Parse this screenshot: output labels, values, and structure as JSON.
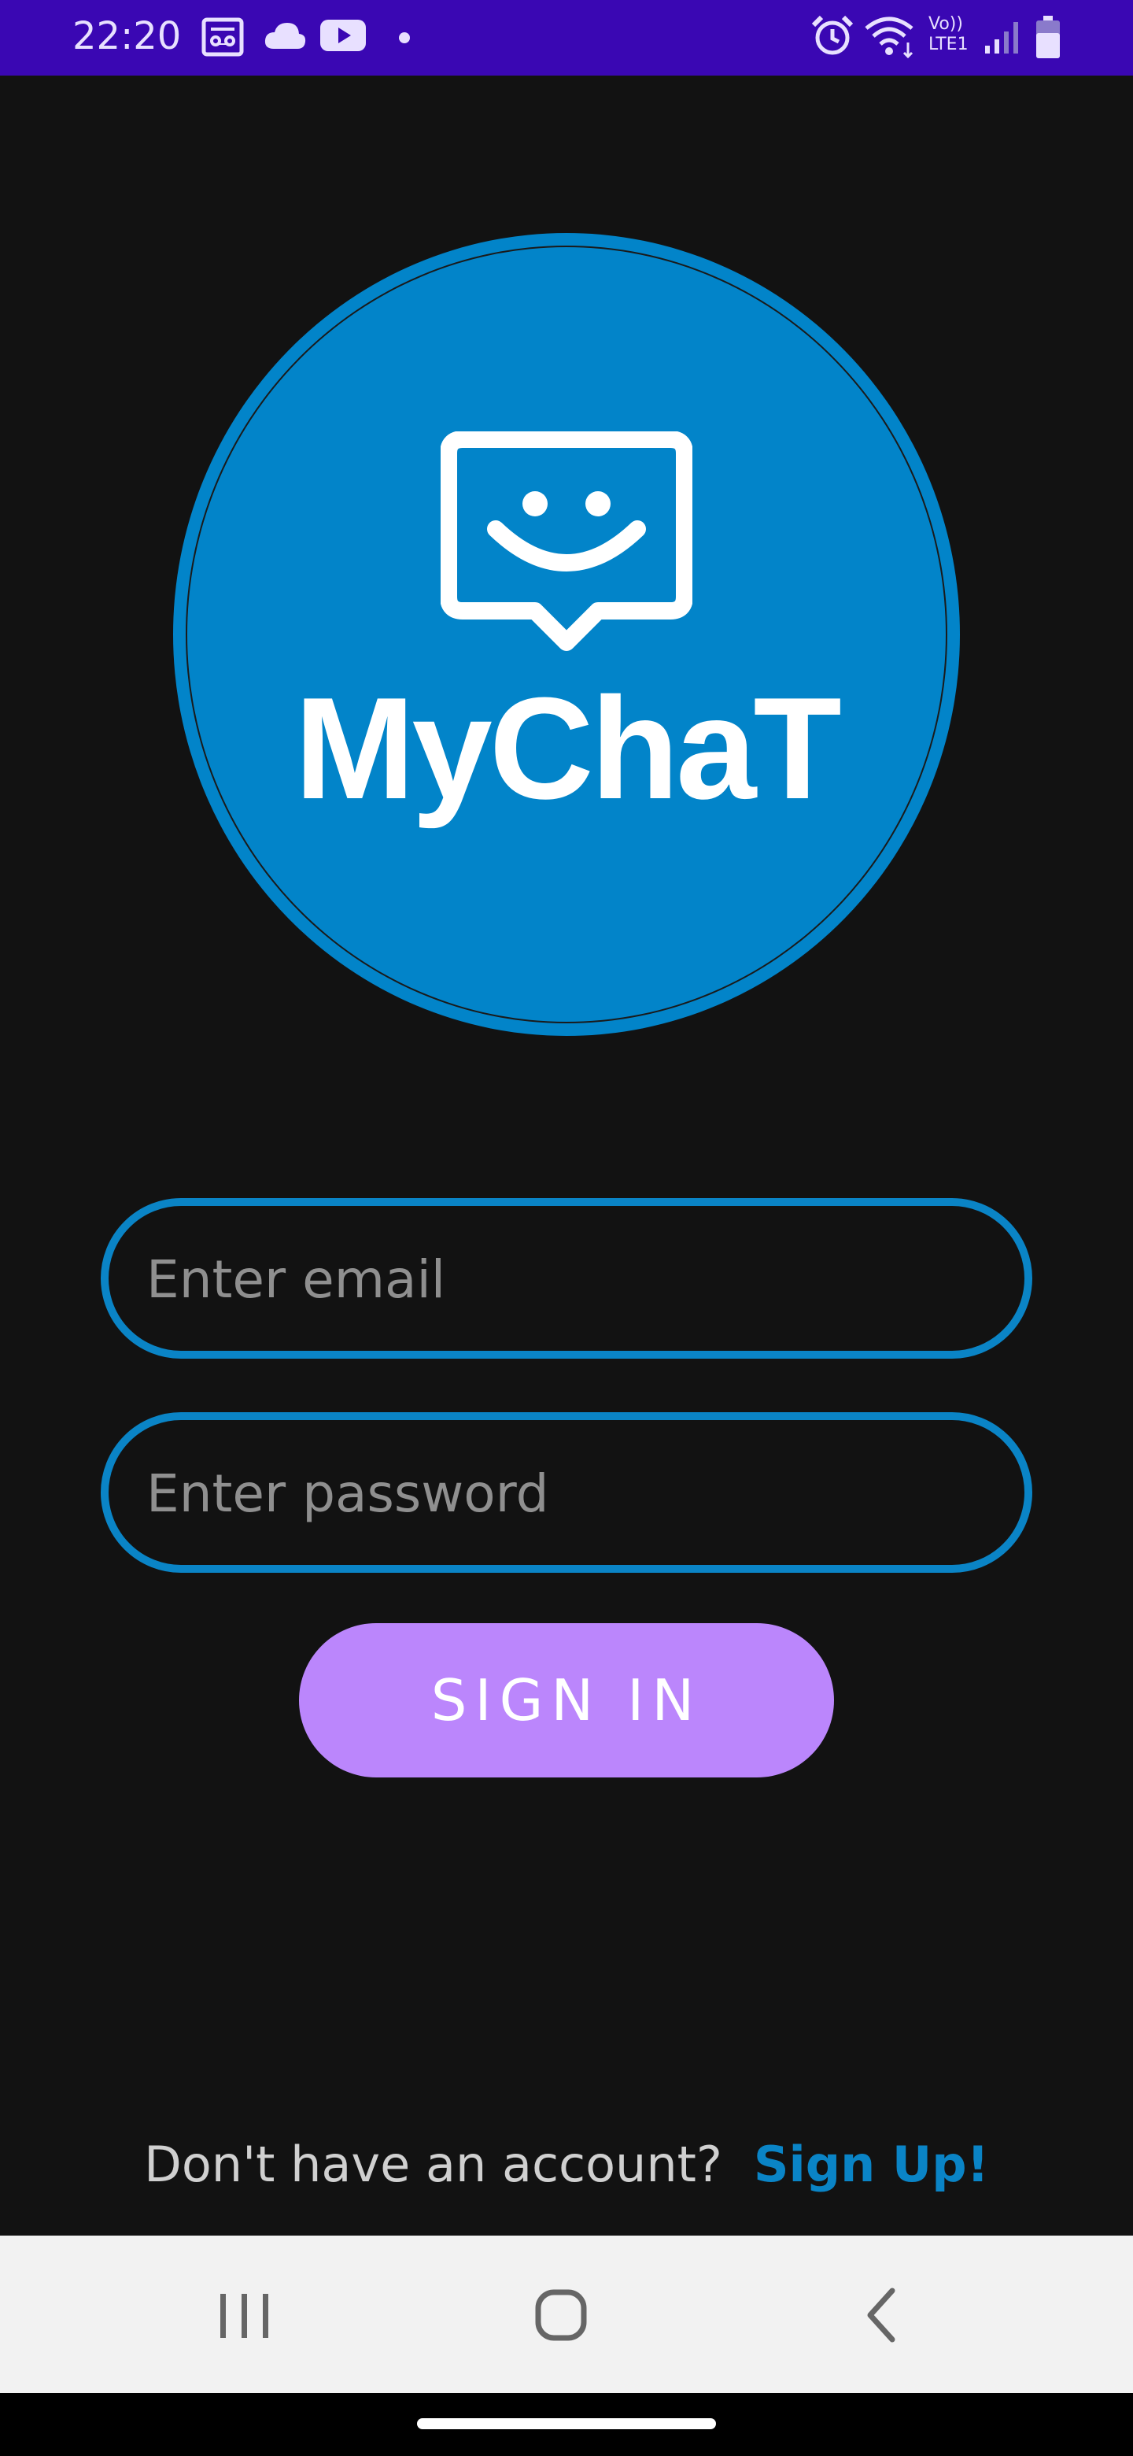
{
  "status_bar": {
    "time": "22:20",
    "left_icons": [
      "voicemail-icon",
      "cloud-icon",
      "youtube-icon",
      "dot-icon"
    ],
    "right_icons": [
      "alarm-icon",
      "wifi-icon",
      "volte-lte-icon",
      "signal-icon",
      "battery-icon"
    ],
    "network_label_top": "Vo))",
    "network_label_bottom": "LTE1",
    "background": "#3a07b3"
  },
  "logo": {
    "title": "MyChaT",
    "icon": "smiley-chat-bubble-icon",
    "circle_color": "#0284c9"
  },
  "form": {
    "email_placeholder": "Enter email",
    "email_value": "",
    "password_placeholder": "Enter password",
    "password_value": "",
    "border_color": "#0a84c6"
  },
  "sign_in": {
    "label": "SIGN IN",
    "color": "#bb86fc"
  },
  "footer": {
    "question": "Don't have an account?",
    "signup_label": "Sign Up!",
    "link_color": "#0a84c6"
  },
  "nav_bar": {
    "buttons": [
      "recent-apps-icon",
      "home-icon",
      "back-icon"
    ]
  },
  "theme": {
    "background": "#121212"
  }
}
